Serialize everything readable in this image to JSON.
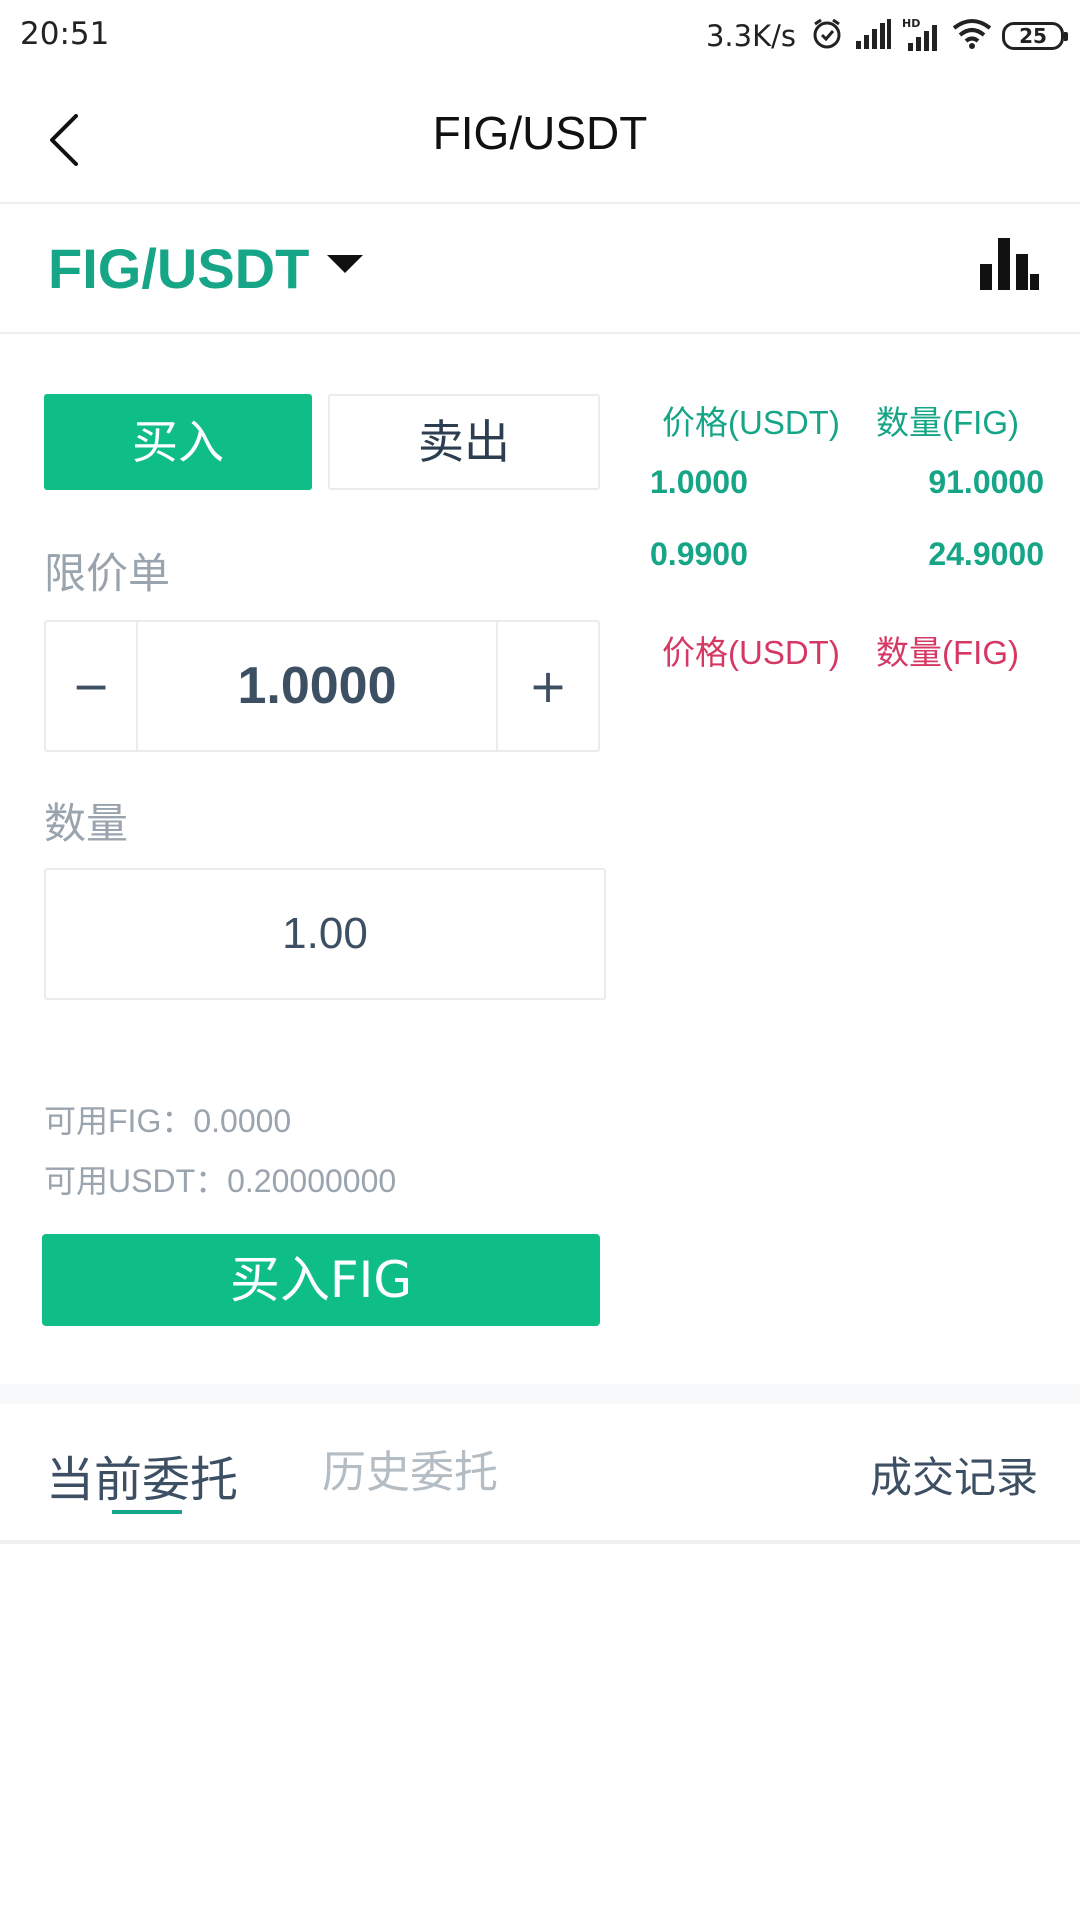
{
  "status_bar": {
    "time": "20:51",
    "net_speed": "3.3K/s",
    "battery": "25",
    "icons": [
      "alarm-icon",
      "signal-icon",
      "hd-signal-icon",
      "wifi-icon",
      "battery-icon"
    ]
  },
  "header": {
    "title": "FIG/USDT",
    "back_icon": "chevron-left-icon"
  },
  "pair_bar": {
    "pair": "FIG/USDT",
    "chart_icon": "bar-chart-icon"
  },
  "trade": {
    "tabs": {
      "buy": "买入",
      "sell": "卖出"
    },
    "order_type": "限价单",
    "price": {
      "minus": "−",
      "value": "1.0000",
      "plus": "+"
    },
    "quantity_label": "数量",
    "quantity_value": "1.00",
    "available_fig": "可用FIG：0.0000",
    "available_usdt": "可用USDT：0.20000000",
    "submit_label": "买入FIG"
  },
  "orderbook": {
    "buy_header": {
      "price": "价格(USDT)",
      "qty": "数量(FIG)"
    },
    "buy_rows": [
      {
        "price": "1.0000",
        "qty": "91.0000"
      },
      {
        "price": "0.9900",
        "qty": "24.9000"
      }
    ],
    "sell_header": {
      "price": "价格(USDT)",
      "qty": "数量(FIG)"
    }
  },
  "orders_tabs": {
    "current": "当前委托",
    "history": "历史委托",
    "records": "成交记录"
  },
  "colors": {
    "accent_green": "#0fbe86",
    "pair_green": "#16a587",
    "sell_red": "#d63864",
    "muted_text": "#9aa4ae"
  }
}
